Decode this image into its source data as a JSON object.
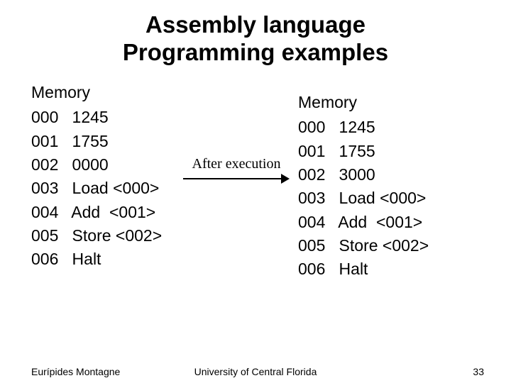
{
  "title_line1": "Assembly  language",
  "title_line2": "Programming examples",
  "left": {
    "header": "Memory",
    "rows": [
      {
        "addr": "000",
        "val": "1245"
      },
      {
        "addr": "001",
        "val": "1755"
      },
      {
        "addr": "002",
        "val": "0000"
      },
      {
        "addr": "003",
        "val": "Load <000>"
      },
      {
        "addr": "004",
        "val": "Add  <001>"
      },
      {
        "addr": "005",
        "val": "Store <002>"
      },
      {
        "addr": "006",
        "val": "Halt"
      }
    ]
  },
  "right": {
    "header": "Memory",
    "rows": [
      {
        "addr": "000",
        "val": "1245"
      },
      {
        "addr": "001",
        "val": "1755"
      },
      {
        "addr": "002",
        "val": "3000"
      },
      {
        "addr": "003",
        "val": "Load <000>"
      },
      {
        "addr": "004",
        "val": "Add  <001>"
      },
      {
        "addr": "005",
        "val": "Store <002>"
      },
      {
        "addr": "006",
        "val": "Halt"
      }
    ]
  },
  "after_label": "After execution",
  "footer": {
    "author": "Eurípides Montagne",
    "org": "University of Central Florida",
    "page": "33"
  }
}
